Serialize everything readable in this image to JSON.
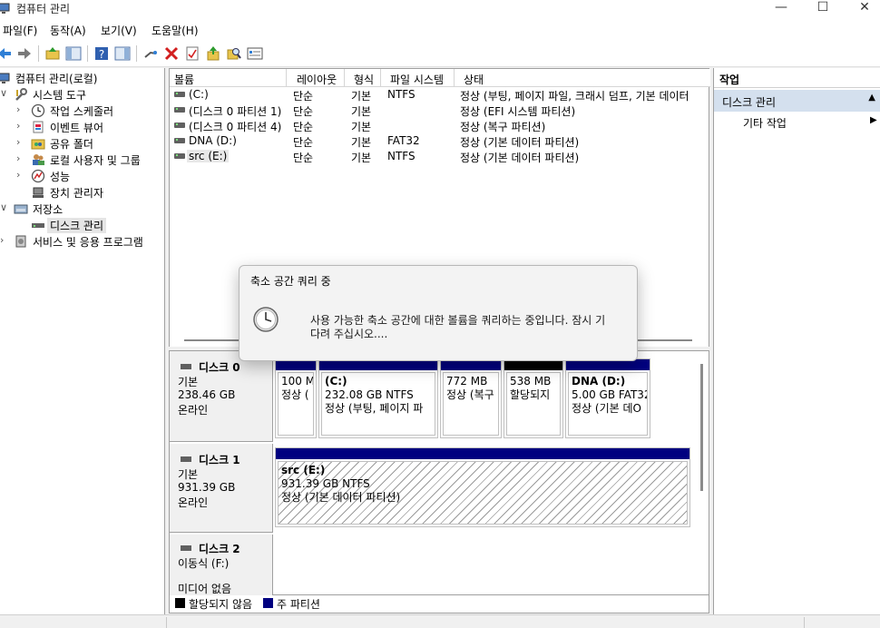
{
  "window": {
    "title": "컴퓨터 관리",
    "controls": {
      "minimize": "—",
      "maximize": "☐",
      "close": "✕"
    }
  },
  "menu": [
    "파일(F)",
    "동작(A)",
    "보기(V)",
    "도움말(H)"
  ],
  "tree": {
    "root": "컴퓨터 관리(로컬)",
    "system_tools": "시스템 도구",
    "task_scheduler": "작업 스케줄러",
    "event_viewer": "이벤트 뷰어",
    "shared_folders": "공유 폴더",
    "local_users": "로컬 사용자 및 그룹",
    "performance": "성능",
    "device_manager": "장치 관리자",
    "storage": "저장소",
    "disk_management": "디스크 관리",
    "services": "서비스 및 응용 프로그램"
  },
  "volume_list": {
    "columns": [
      "볼륨",
      "레이아웃",
      "형식",
      "파일 시스템",
      "상태"
    ],
    "rows": [
      {
        "name": "(C:)",
        "layout": "단순",
        "type": "기본",
        "fs": "NTFS",
        "status": "정상 (부팅, 페이지 파일, 크래시 덤프, 기본 데이터"
      },
      {
        "name": "(디스크 0 파티션 1)",
        "layout": "단순",
        "type": "기본",
        "fs": "",
        "status": "정상 (EFI 시스템 파티션)"
      },
      {
        "name": "(디스크 0 파티션 4)",
        "layout": "단순",
        "type": "기본",
        "fs": "",
        "status": "정상 (복구 파티션)"
      },
      {
        "name": "DNA (D:)",
        "layout": "단순",
        "type": "기본",
        "fs": "FAT32",
        "status": "정상 (기본 데이터 파티션)"
      },
      {
        "name": "src (E:)",
        "layout": "단순",
        "type": "기본",
        "fs": "NTFS",
        "status": "정상 (기본 데이터 파티션)"
      }
    ]
  },
  "disks": [
    {
      "name": "디스크 0",
      "kind": "기본",
      "size": "238.46 GB",
      "state": "온라인",
      "partitions": [
        {
          "line1": "",
          "line2": "100 M",
          "line3": "정상 ("
        },
        {
          "line1": "(C:)",
          "line2": "232.08 GB NTFS",
          "line3": "정상 (부팅, 페이지 파"
        },
        {
          "line1": "",
          "line2": "772 MB",
          "line3": "정상 (복구"
        },
        {
          "line1": "",
          "line2": "538 MB",
          "line3": "할당되지"
        },
        {
          "line1": "DNA  (D:)",
          "line2": "5.00 GB FAT32",
          "line3": "정상 (기본 데O"
        }
      ]
    },
    {
      "name": "디스크 1",
      "kind": "기본",
      "size": "931.39 GB",
      "state": "온라인",
      "partitions": [
        {
          "line1": "src  (E:)",
          "line2": "931.39 GB NTFS",
          "line3": "정상 (기본 데이터 파티션)"
        }
      ]
    },
    {
      "name": "디스크 2",
      "kind": "이동식 (F:)",
      "size": "",
      "state": "미디어 없음",
      "partitions": []
    }
  ],
  "legend": [
    {
      "label": "할당되지 않음",
      "color": "#000000"
    },
    {
      "label": "주 파티션",
      "color": "#000080"
    }
  ],
  "actions": {
    "title": "작업",
    "section": "디스크 관리",
    "item": "기타 작업"
  },
  "dialog": {
    "title": "축소 공간 쿼리 중",
    "message_line1": "사용 가능한 축소 공간에 대한 볼륨을 쿼리하는 중입니다. 잠시 기",
    "message_line2": "다려 주십시오...."
  }
}
